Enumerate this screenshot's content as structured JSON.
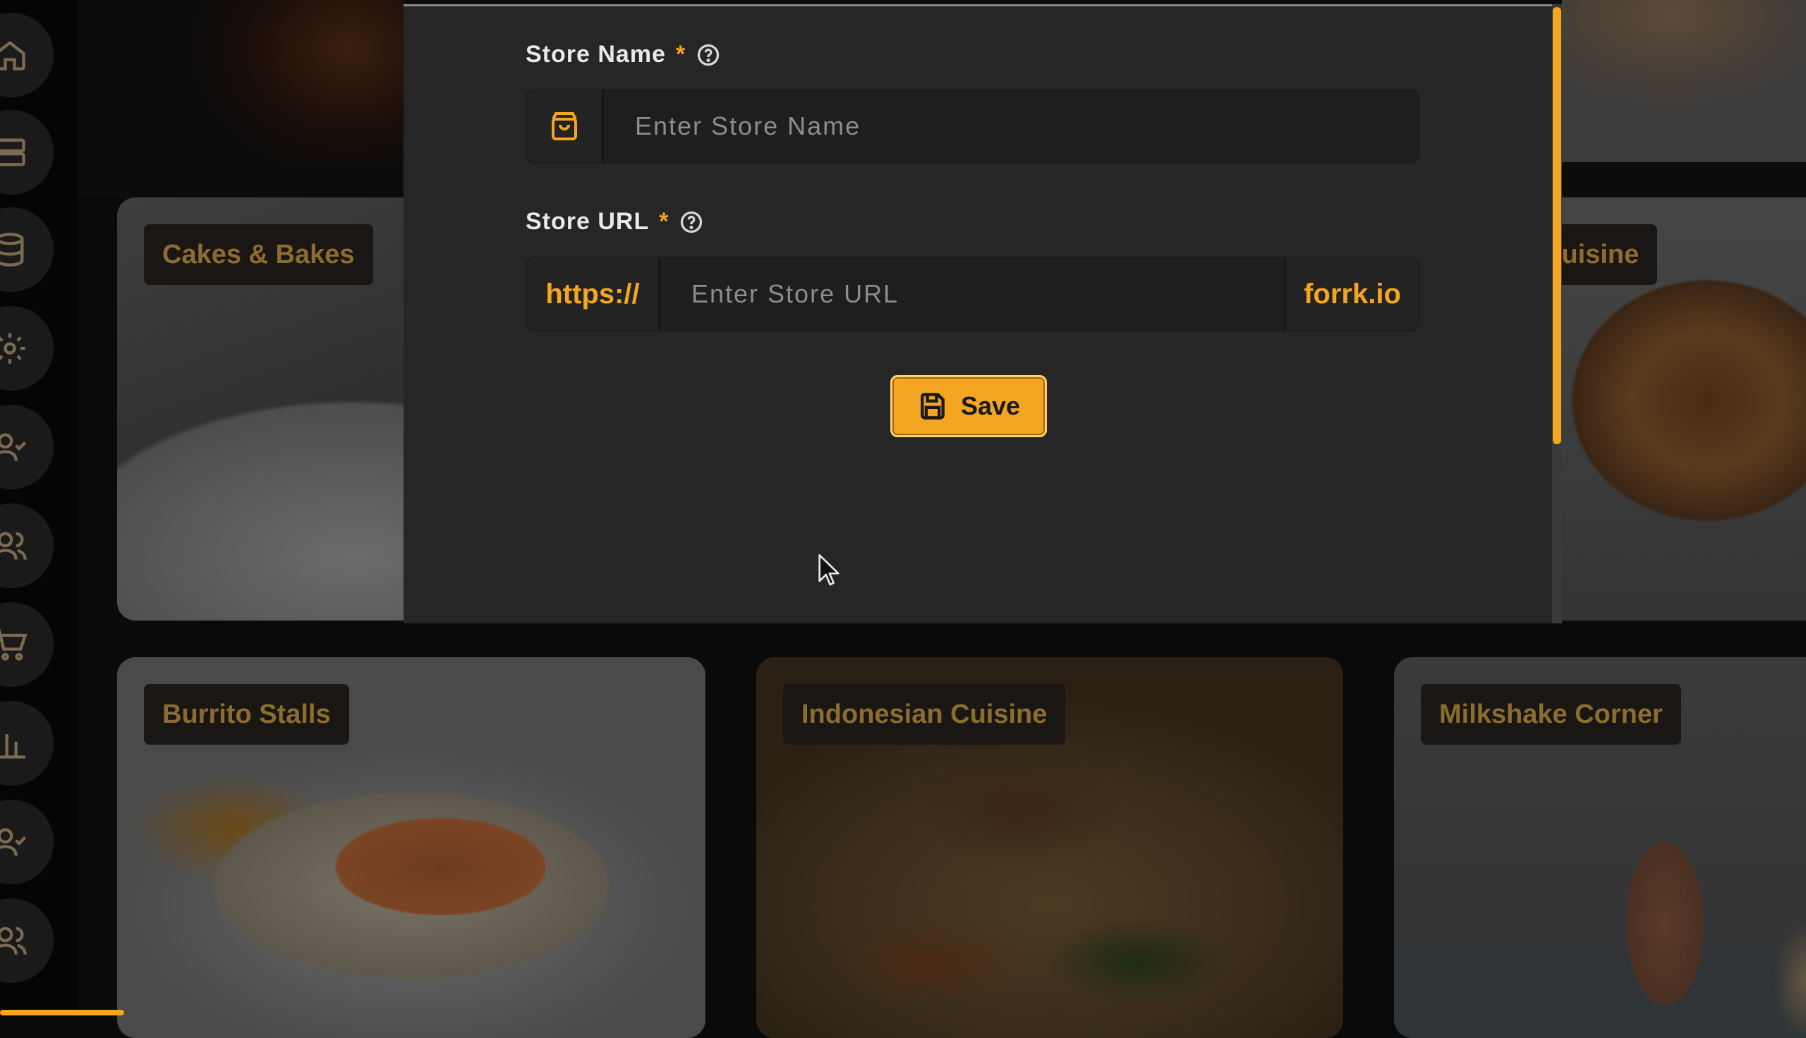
{
  "modal": {
    "store_name": {
      "label": "Store Name",
      "required_mark": "*",
      "placeholder": "Enter Store Name",
      "value": "",
      "addon_icon": "shopping-bag-icon"
    },
    "store_url": {
      "label": "Store URL",
      "required_mark": "*",
      "placeholder": "Enter Store URL",
      "value": "",
      "prefix": "https://",
      "suffix": "forrk.io"
    },
    "save_button": {
      "label": "Save",
      "icon": "floppy-disk-icon"
    }
  },
  "background": {
    "cards": [
      {
        "label": "Cakes & Bakes"
      },
      {
        "label": "Cuisine"
      },
      {
        "label": "Burrito Stalls"
      },
      {
        "label": "Indonesian Cuisine"
      },
      {
        "label": "Milkshake Corner"
      }
    ],
    "sidebar_icons": [
      "home-icon",
      "server-icon",
      "database-icon",
      "gear-icon",
      "user-check-icon",
      "users-icon",
      "cart-icon",
      "bar-chart-icon",
      "user-check-icon",
      "users-icon"
    ]
  },
  "colors": {
    "accent": "#f4a522",
    "modal_bg": "#262626",
    "input_bg": "#1e1e1e",
    "page_bg": "#0a0a0a"
  }
}
